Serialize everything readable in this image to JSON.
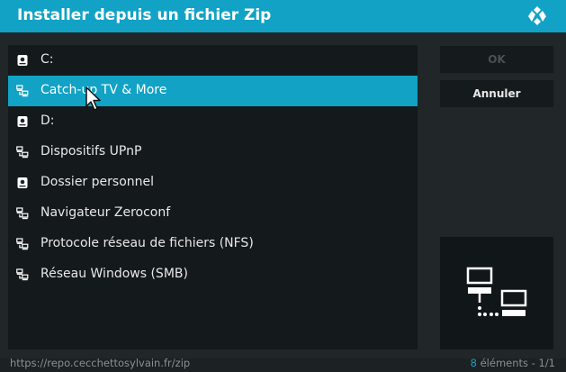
{
  "dialog": {
    "title": "Installer depuis un fichier Zip"
  },
  "list": {
    "items": [
      {
        "label": "C:",
        "icon": "drive-icon",
        "selected": false
      },
      {
        "label": "Catch-up TV & More",
        "icon": "network-icon",
        "selected": true
      },
      {
        "label": "D:",
        "icon": "drive-icon",
        "selected": false
      },
      {
        "label": "Dispositifs UPnP",
        "icon": "network-icon",
        "selected": false
      },
      {
        "label": "Dossier personnel",
        "icon": "drive-icon",
        "selected": false
      },
      {
        "label": "Navigateur Zeroconf",
        "icon": "network-icon",
        "selected": false
      },
      {
        "label": "Protocole réseau de fichiers (NFS)",
        "icon": "network-icon",
        "selected": false
      },
      {
        "label": "Réseau Windows (SMB)",
        "icon": "network-icon",
        "selected": false
      }
    ]
  },
  "buttons": {
    "ok_label": "OK",
    "cancel_label": "Annuler"
  },
  "preview": {
    "icon": "network-icon"
  },
  "status": {
    "url": "https://repo.cecchettosylvain.fr/zip",
    "count_number": "8",
    "count_rest": "éléments - 1/1"
  },
  "colors": {
    "accent": "#12a2c5",
    "background": "#212628",
    "list_background": "#14191b"
  }
}
